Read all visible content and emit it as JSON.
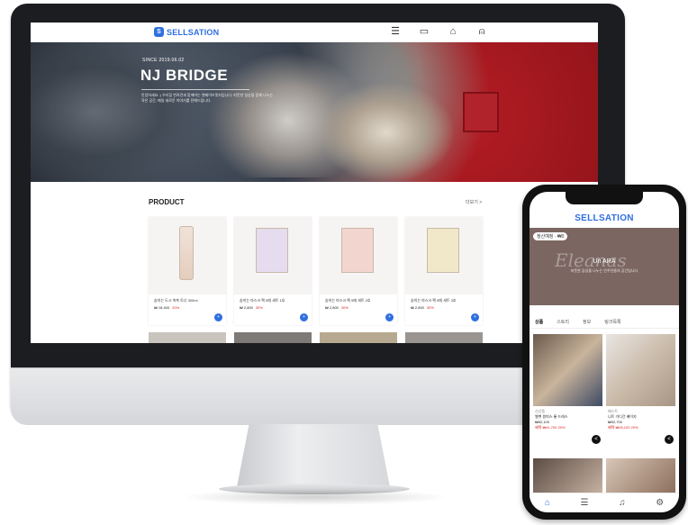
{
  "desktop": {
    "logo": "SELLSATION",
    "nav_icons": [
      "list-search-icon",
      "coupon-icon",
      "bag-icon",
      "user-icon"
    ],
    "hero": {
      "since": "SINCE 2019.06.02",
      "title": "NJ BRIDGE",
      "description": "안녕하세요 :) 우리집 반려견과 함께하는 엔제이브릿지입니다. 따뜻한 일상을 함께 나누는 작은 공간, 매일 새로운 이야기를 전해드립니다."
    },
    "section": {
      "title": "PRODUCT",
      "more": "더보기 >"
    },
    "products": [
      {
        "name": "숨쉬는 도시 촉촉 토너 300ml",
        "price": "₩ 18,400",
        "discount": "20%"
      },
      {
        "name": "숨쉬는 마스크 팩 5매 세트 1호",
        "price": "₩ 2,800",
        "discount": "30%"
      },
      {
        "name": "숨쉬는 마스크 팩 5매 세트 2호",
        "price": "₩ 2,800",
        "discount": "30%"
      },
      {
        "name": "숨쉬는 마스크 팩 5매 세트 3호",
        "price": "₩ 2,800",
        "discount": "30%"
      }
    ]
  },
  "mobile": {
    "logo": "SELLSATION",
    "badge": "정산예정 · ₩0",
    "script": "Eleanas",
    "name": "Un ARA",
    "subtitle": "따뜻한 감성을 나누는 안주인들의 공간입니다",
    "tabs": [
      "상품",
      "스토리",
      "정보",
      "링크목록"
    ],
    "products": [
      {
        "tag": "신상품",
        "name": "벨벳 원피스 롱 드레스",
        "price": "₩52,100",
        "discount": "혜택 ₩41,700 20%"
      },
      {
        "tag": "베스트",
        "name": "니트 가디건 베이지",
        "price": "₩32,700",
        "discount": "혜택 ₩26,100 20%"
      }
    ],
    "bottom_nav": [
      "home-icon",
      "list-icon",
      "bell-icon",
      "settings-icon"
    ]
  },
  "colors": {
    "brand": "#2f6fe0",
    "discount": "#dd2222",
    "banner": "#7b6661"
  }
}
